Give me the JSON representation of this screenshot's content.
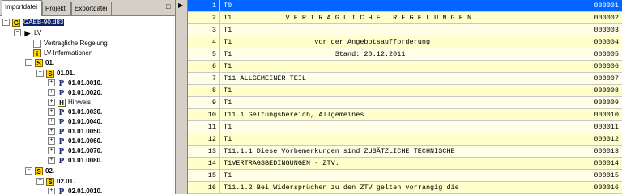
{
  "tabs": [
    "Importdatei",
    "Projekt",
    "Exportdatei"
  ],
  "tree": {
    "root": "GAEB-90.d83",
    "lv": "LV",
    "vertragliche": "Vertragliche Regelung",
    "lvinfo": "LV-Informationen",
    "s01": "01.",
    "s0101": "01.01.",
    "p1": "01.01.0010.",
    "p2": "01.01.0020.",
    "hinweis": "Hinweis",
    "p3": "01.01.0030.",
    "p4": "01.01.0040.",
    "p5": "01.01.0050.",
    "p6": "01.01.0060.",
    "p7": "01.01.0070.",
    "p8": "01.01.0080.",
    "s02": "02.",
    "s0201": "02.01.",
    "p9": "02.01.0010."
  },
  "grid": {
    "rows": [
      {
        "n": "1",
        "text": "T0",
        "code": "000001"
      },
      {
        "n": "2",
        "text": "T1             V E R T R A G L I C H E   R E G E L U N G E N",
        "code": "000002"
      },
      {
        "n": "3",
        "text": "T1",
        "code": "000003"
      },
      {
        "n": "4",
        "text": "T1                    vor der Angebotsaufforderung",
        "code": "000004"
      },
      {
        "n": "5",
        "text": "T1                         Stand: 20.12.2011",
        "code": "000005"
      },
      {
        "n": "6",
        "text": "T1",
        "code": "000006"
      },
      {
        "n": "7",
        "text": "T11 ALLGEMEINER TEIL",
        "code": "000007"
      },
      {
        "n": "8",
        "text": "T1",
        "code": "000008"
      },
      {
        "n": "9",
        "text": "T1",
        "code": "000009"
      },
      {
        "n": "10",
        "text": "T11.1 Geltungsbereich, Allgemeines",
        "code": "000010"
      },
      {
        "n": "11",
        "text": "T1",
        "code": "000011"
      },
      {
        "n": "12",
        "text": "T1",
        "code": "000012"
      },
      {
        "n": "13",
        "text": "T11.1.1 Diese Vorbemerkungen sind ZUSÄTZLICHE TECHNISCHE",
        "code": "000013"
      },
      {
        "n": "14",
        "text": "T1VERTRAGSBEDINGUNGEN - ZTV.",
        "code": "000014"
      },
      {
        "n": "15",
        "text": "T1",
        "code": "000015"
      },
      {
        "n": "16",
        "text": "T11.1.2 Bei Widersprüchen zu den ZTV gelten vorrangig die",
        "code": "000016"
      }
    ]
  }
}
